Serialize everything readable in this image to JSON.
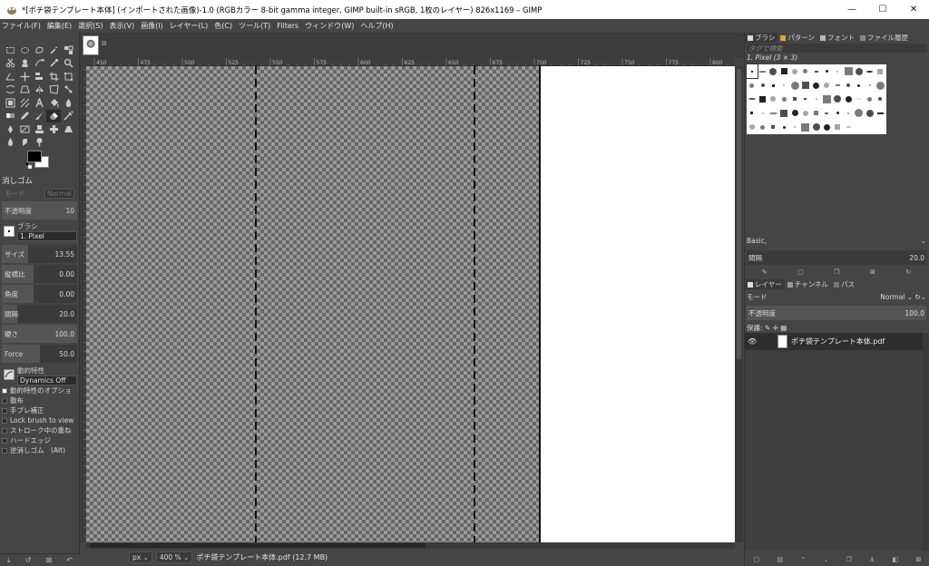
{
  "window": {
    "title": "*[ポチ袋テンプレート本体] (インポートされた画像)-1.0 (RGBカラー 8-bit gamma integer, GIMP built-in sRGB, 1枚のレイヤー) 826x1169 – GIMP",
    "minimize": "—",
    "maximize": "☐",
    "close": "✕"
  },
  "menu": [
    "ファイル(F)",
    "編集(E)",
    "選択(S)",
    "表示(V)",
    "画像(I)",
    "レイヤー(L)",
    "色(C)",
    "ツール(T)",
    "Filters",
    "ウィンドウ(W)",
    "ヘルプ(H)"
  ],
  "tool_options": {
    "title": "消しゴム",
    "mode_label": "モード",
    "mode_value": "Normal",
    "opacity_label": "不透明度",
    "opacity_value": "10",
    "brush_label": "ブラシ",
    "brush_value": "1. Pixel",
    "size_label": "サイズ",
    "size_value": "13.55",
    "aspect_label": "縦横比",
    "aspect_value": "0.00",
    "angle_label": "角度",
    "angle_value": "0.00",
    "spacing_label": "間隔",
    "spacing_value": "20.0",
    "hardness_label": "硬さ",
    "hardness_value": "100.0",
    "force_label": "Force",
    "force_value": "50.0",
    "dynamics_label": "動的特性",
    "dynamics_value": "Dynamics Off",
    "checks": [
      {
        "label": "動的特性のオプショ",
        "checked": true
      },
      {
        "label": "散布",
        "checked": false
      },
      {
        "label": "手ブレ補正",
        "checked": false
      },
      {
        "label": "Lock brush to view",
        "checked": false
      },
      {
        "label": "ストローク中の重ね",
        "checked": false
      },
      {
        "label": "ハードエッジ",
        "checked": false
      },
      {
        "label": "逆消しゴム　(Alt)",
        "checked": false
      }
    ]
  },
  "ruler_labels": [
    "450",
    "475",
    "500",
    "525",
    "550",
    "575",
    "600",
    "625",
    "650",
    "675",
    "700",
    "725",
    "750",
    "775",
    "800"
  ],
  "status": {
    "unit": "px",
    "zoom": "400 %",
    "file": "ポチ袋テンプレート本体.pdf (12.7 MB)"
  },
  "brushes_dock": {
    "tabs": [
      "ブラシ",
      "パターン",
      "フォント",
      "ファイル履歴"
    ],
    "search_placeholder": "タグで検索",
    "selected_brush": "1. Pixel (3 × 3)",
    "tag": "Basic,",
    "spacing_label": "間隔",
    "spacing_value": "20.0"
  },
  "layers_dock": {
    "tabs": [
      "レイヤー",
      "チャンネル",
      "パス"
    ],
    "mode_label": "モード",
    "mode_value": "Normal",
    "opacity_label": "不透明度",
    "opacity_value": "100.0",
    "lock_label": "保護:",
    "layer_name": "ポチ袋テンプレート本体.pdf"
  },
  "colors": {
    "accent_fill": "#555555",
    "foreground": "#000000",
    "background": "#ffffff"
  }
}
